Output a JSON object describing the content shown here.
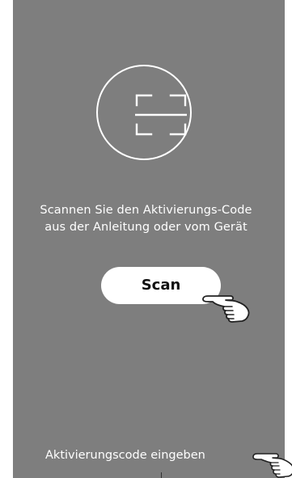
{
  "colors": {
    "panel_background": "#7e7e7e",
    "foreground": "#ffffff",
    "button_text": "#111111"
  },
  "scanner": {
    "icon": "scan-frame-icon"
  },
  "instruction": {
    "line1": "Scannen Sie den Aktivierungs-Code",
    "line2": "aus der Anleitung oder vom Gerät"
  },
  "scan_button": {
    "label": "Scan",
    "pointer_icon": "pointing-hand-icon"
  },
  "manual_entry": {
    "label": "Aktivierungscode eingeben",
    "pointer_icon": "pointing-hand-icon"
  }
}
